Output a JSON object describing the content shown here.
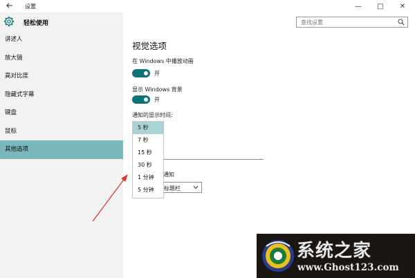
{
  "window": {
    "title": "设置",
    "app_name": "轻松使用",
    "back_icon": "back-arrow-icon"
  },
  "controls": {
    "minimize": "—",
    "maximize": "□",
    "close": "✕"
  },
  "sidebar": {
    "items": [
      {
        "label": "讲述人"
      },
      {
        "label": "放大镜"
      },
      {
        "label": "高对比度"
      },
      {
        "label": "隐藏式字幕"
      },
      {
        "label": "键盘"
      },
      {
        "label": "鼠标"
      },
      {
        "label": "其他选项",
        "active": true
      }
    ]
  },
  "search": {
    "placeholder": "查找设置"
  },
  "main": {
    "heading": "视觉选项",
    "animations_label": "在 Windows 中播放动画",
    "animations_state": "开",
    "background_label": "显示 Windows 背景",
    "background_state": "开",
    "notify_time_label": "通知的显示时间:",
    "partial_text": "通知",
    "combo_partial_value": "标题栏"
  },
  "dropdown": {
    "options": [
      "5 秒",
      "7 秒",
      "15 秒",
      "30 秒",
      "1 分钟",
      "5 分钟"
    ],
    "selected_index": 0
  },
  "watermark": {
    "title": "系统之家",
    "url": "www.Ghost123.com"
  },
  "colors": {
    "accent": "#0d7377",
    "sidebar_active": "#7ab8bb",
    "dropdown_selected": "#a9d3d5",
    "annotation_arrow": "#d93a2f"
  }
}
